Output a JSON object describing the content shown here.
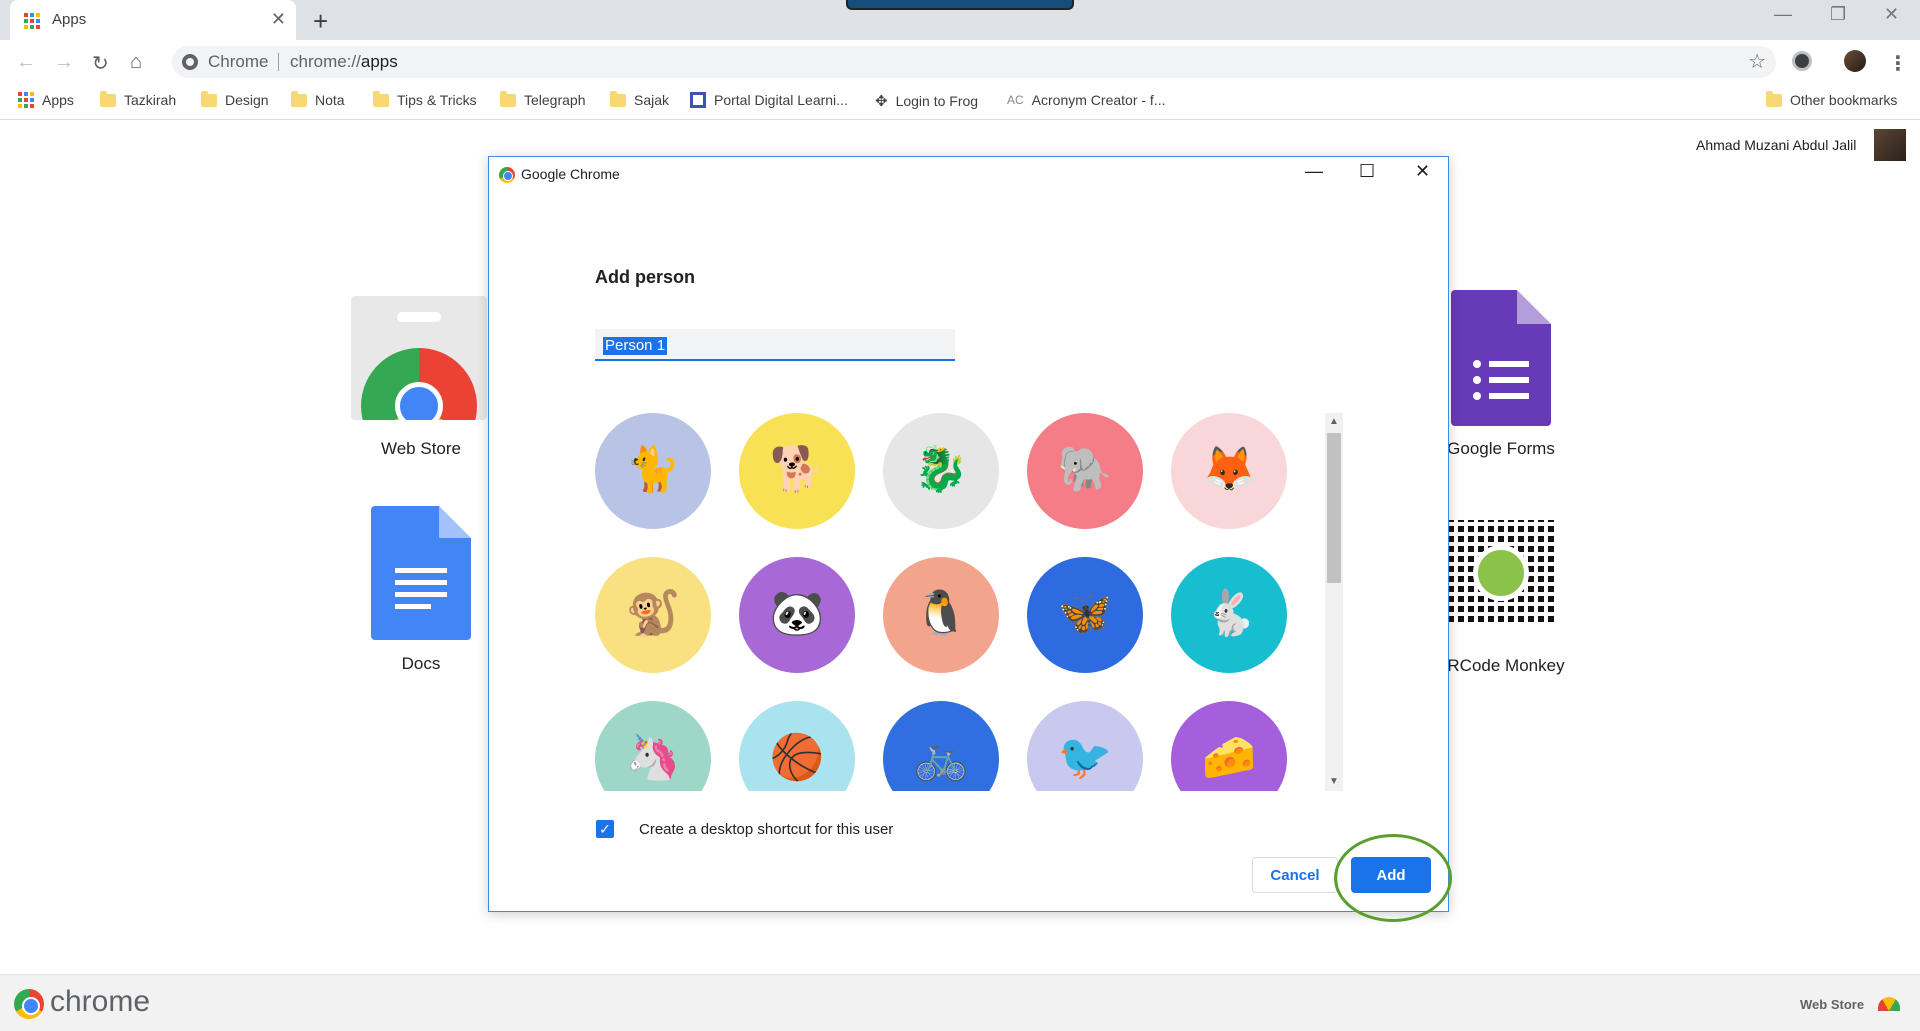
{
  "browser": {
    "tab_title": "Apps",
    "new_tab_label": "+",
    "omnibox_chip": "Chrome",
    "url_scheme": "chrome://",
    "url_path": "apps"
  },
  "bookmarks": [
    {
      "label": "Apps",
      "icon": "apps-grid-icon"
    },
    {
      "label": "Tazkirah",
      "icon": "folder-icon"
    },
    {
      "label": "Design",
      "icon": "folder-icon"
    },
    {
      "label": "Nota",
      "icon": "folder-icon"
    },
    {
      "label": "Tips & Tricks",
      "icon": "folder-icon"
    },
    {
      "label": "Telegraph",
      "icon": "folder-icon"
    },
    {
      "label": "Sajak",
      "icon": "folder-icon"
    },
    {
      "label": "Portal Digital Learni...",
      "icon": "portal-icon"
    },
    {
      "label": "Login to Frog",
      "icon": "frog-icon"
    },
    {
      "label": "Acronym Creator - f...",
      "icon": "ac-icon"
    }
  ],
  "other_bookmarks": "Other bookmarks",
  "profile": {
    "name": "Ahmad Muzani Abdul Jalil"
  },
  "apps": {
    "web_store": "Web Store",
    "docs": "Docs",
    "google_forms": "Google Forms",
    "qrcode_monkey": "RCode Monkey"
  },
  "dialog": {
    "window_title": "Google Chrome",
    "heading": "Add person",
    "name_value": "Person 1",
    "avatars": [
      {
        "name": "cat",
        "bg": "#b9c3e6",
        "glyph": "🐈"
      },
      {
        "name": "corgi",
        "bg": "#f9e155",
        "glyph": "🐕"
      },
      {
        "name": "dragon",
        "bg": "#e6e6e6",
        "glyph": "🐉"
      },
      {
        "name": "elephant",
        "bg": "#f47d87",
        "glyph": "🐘"
      },
      {
        "name": "fox",
        "bg": "#f9d6d8",
        "glyph": "🦊"
      },
      {
        "name": "monkey",
        "bg": "#f9e181",
        "glyph": "🐒"
      },
      {
        "name": "panda",
        "bg": "#a769d5",
        "glyph": "🐼"
      },
      {
        "name": "penguin",
        "bg": "#f3a48d",
        "glyph": "🐧"
      },
      {
        "name": "butterfly",
        "bg": "#2e6ae0",
        "glyph": "🦋"
      },
      {
        "name": "rabbit",
        "bg": "#17bed0",
        "glyph": "🐇"
      },
      {
        "name": "unicorn",
        "bg": "#9ed6c8",
        "glyph": "🦄"
      },
      {
        "name": "basketball",
        "bg": "#a9e3ef",
        "glyph": "🏀"
      },
      {
        "name": "bicycle",
        "bg": "#2f6fe0",
        "glyph": "🚲"
      },
      {
        "name": "bird",
        "bg": "#c9c8ee",
        "glyph": "🐦"
      },
      {
        "name": "cheese",
        "bg": "#a55edc",
        "glyph": "🧀"
      }
    ],
    "checkbox_label": "Create a desktop shortcut for this user",
    "checkbox_checked": true,
    "cancel_label": "Cancel",
    "add_label": "Add"
  },
  "bottom": {
    "wordmark": "chrome",
    "web_store": "Web Store"
  },
  "colors": {
    "accent": "#1a73e8",
    "highlight_ring": "#5a9e2f"
  }
}
